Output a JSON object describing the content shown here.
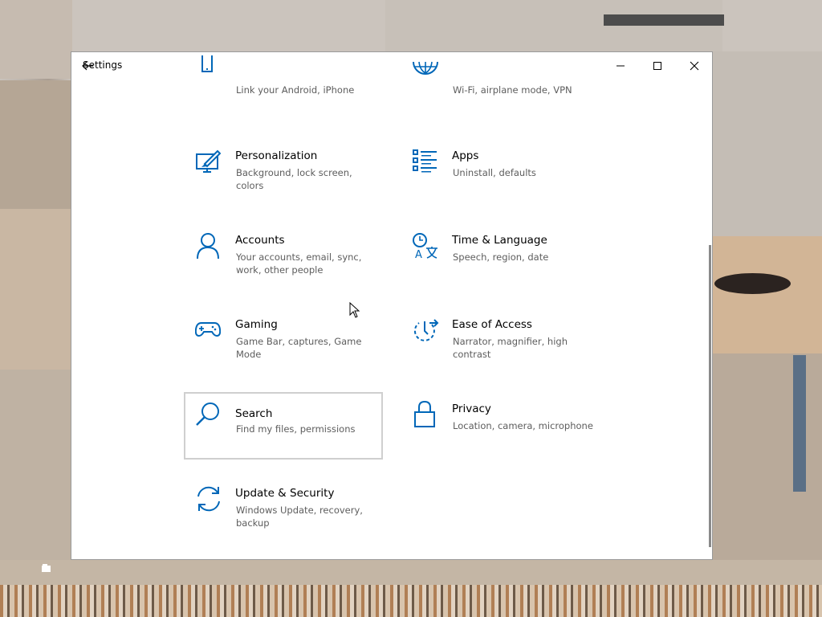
{
  "window": {
    "title": "Settings",
    "controls": {
      "minimize_icon": "minimize-icon",
      "maximize_icon": "maximize-icon",
      "close_icon": "close-icon"
    }
  },
  "accent_color": "#0067b8",
  "tiles": [
    {
      "label": "",
      "desc": "Link your Android, iPhone",
      "icon": "phone-icon"
    },
    {
      "label": "",
      "desc": "Wi-Fi, airplane mode, VPN",
      "icon": "globe-icon"
    },
    {
      "label": "Personalization",
      "desc": "Background, lock screen, colors",
      "icon": "personalization-icon"
    },
    {
      "label": "Apps",
      "desc": "Uninstall, defaults",
      "icon": "apps-icon"
    },
    {
      "label": "Accounts",
      "desc": "Your accounts, email, sync, work, other people",
      "icon": "person-icon"
    },
    {
      "label": "Time & Language",
      "desc": "Speech, region, date",
      "icon": "time-language-icon"
    },
    {
      "label": "Gaming",
      "desc": "Game Bar, captures, Game Mode",
      "icon": "gamepad-icon"
    },
    {
      "label": "Ease of Access",
      "desc": "Narrator, magnifier, high contrast",
      "icon": "ease-of-access-icon"
    },
    {
      "label": "Search",
      "desc": "Find my files, permissions",
      "icon": "search-icon"
    },
    {
      "label": "Privacy",
      "desc": "Location, camera, microphone",
      "icon": "lock-icon"
    },
    {
      "label": "Update & Security",
      "desc": "Windows Update, recovery, backup",
      "icon": "update-icon"
    }
  ]
}
